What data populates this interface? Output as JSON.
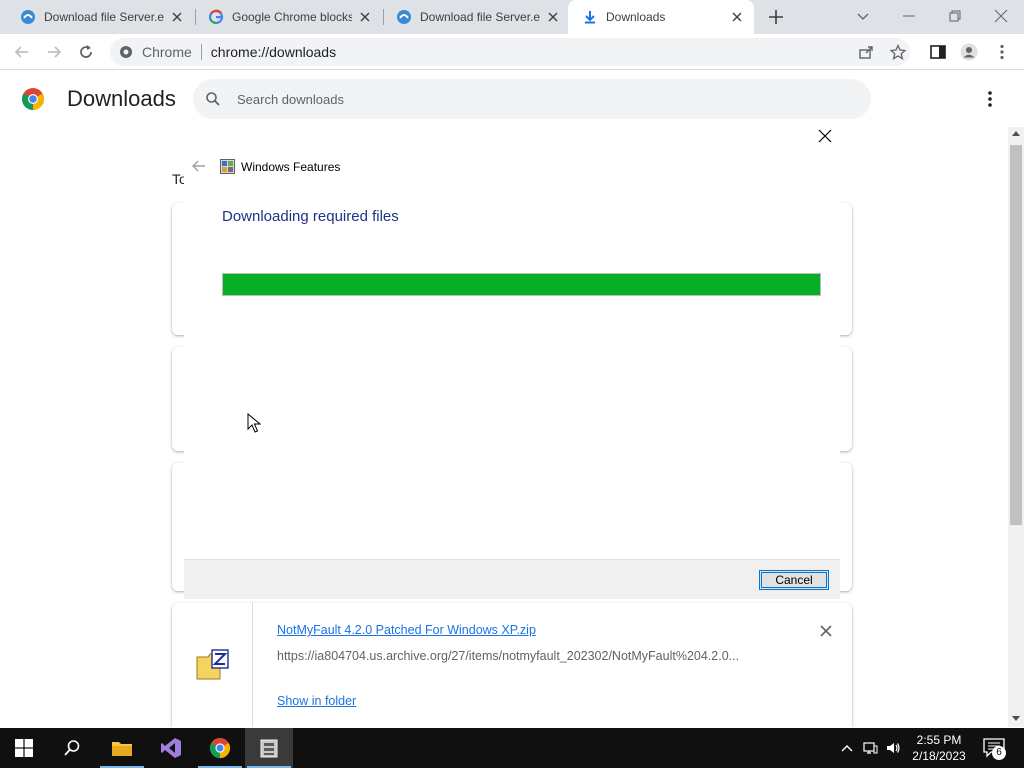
{
  "browser": {
    "tabs": [
      {
        "title": "Download file Server.e",
        "icon": "edge-download-icon",
        "active": false
      },
      {
        "title": "Google Chrome blocks",
        "icon": "google-g-icon",
        "active": false
      },
      {
        "title": "Download file Server.e",
        "icon": "edge-download-icon",
        "active": false
      },
      {
        "title": "Downloads",
        "icon": "download-arrow-icon",
        "active": true
      }
    ],
    "omnibox": {
      "site": "Chrome",
      "url": "chrome://downloads"
    }
  },
  "downloads": {
    "title": "Downloads",
    "search_placeholder": "Search downloads",
    "date_group": "To",
    "item": {
      "filename": "NotMyFault 4.2.0 Patched For Windows XP.zip",
      "url": "https://ia804704.us.archive.org/27/items/notmyfault_202302/NotMyFault%204.2.0...",
      "show_in_folder": "Show in folder"
    }
  },
  "dialog": {
    "title": "Windows Features",
    "heading": "Downloading required files",
    "progress_fraction": 1.0,
    "cancel_label": "Cancel"
  },
  "taskbar": {
    "time": "2:55 PM",
    "date": "2/18/2023",
    "notification_count": "6"
  },
  "colors": {
    "progress_green": "#06b025",
    "link_blue": "#1a73e8",
    "dialog_heading": "#1e3287"
  }
}
